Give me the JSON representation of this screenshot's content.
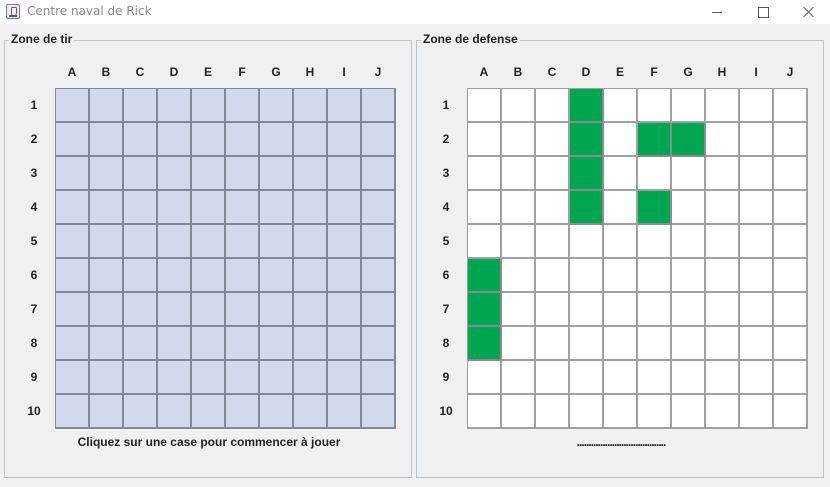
{
  "window": {
    "title": "Centre naval de Rick"
  },
  "columns": [
    "A",
    "B",
    "C",
    "D",
    "E",
    "F",
    "G",
    "H",
    "I",
    "J"
  ],
  "rows": [
    "1",
    "2",
    "3",
    "4",
    "5",
    "6",
    "7",
    "8",
    "9",
    "10"
  ],
  "attack_zone": {
    "title": "Zone de tir",
    "status": "Cliquez sur une case pour commencer à jouer"
  },
  "defense_zone": {
    "title": "Zone de defense",
    "status": "......................................",
    "ship_cells": [
      "D1",
      "D2",
      "F2",
      "G2",
      "D3",
      "D4",
      "F4",
      "A6",
      "A7",
      "A8"
    ]
  },
  "colors": {
    "attack_cell": "#d3d9ec",
    "defense_cell": "#ffffff",
    "ship": "#00a651"
  }
}
